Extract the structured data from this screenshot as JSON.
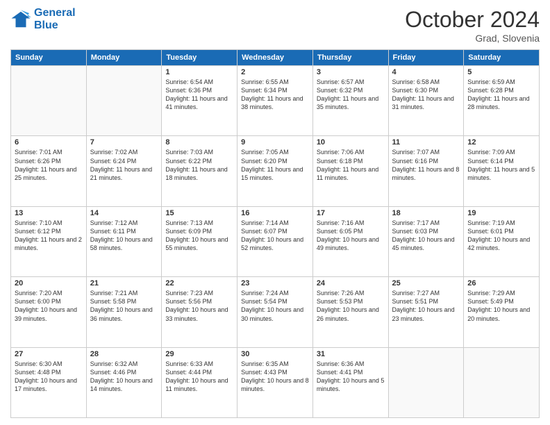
{
  "header": {
    "logo_line1": "General",
    "logo_line2": "Blue",
    "month_title": "October 2024",
    "subtitle": "Grad, Slovenia"
  },
  "weekdays": [
    "Sunday",
    "Monday",
    "Tuesday",
    "Wednesday",
    "Thursday",
    "Friday",
    "Saturday"
  ],
  "weeks": [
    [
      {
        "day": "",
        "info": ""
      },
      {
        "day": "",
        "info": ""
      },
      {
        "day": "1",
        "info": "Sunrise: 6:54 AM\nSunset: 6:36 PM\nDaylight: 11 hours and 41 minutes."
      },
      {
        "day": "2",
        "info": "Sunrise: 6:55 AM\nSunset: 6:34 PM\nDaylight: 11 hours and 38 minutes."
      },
      {
        "day": "3",
        "info": "Sunrise: 6:57 AM\nSunset: 6:32 PM\nDaylight: 11 hours and 35 minutes."
      },
      {
        "day": "4",
        "info": "Sunrise: 6:58 AM\nSunset: 6:30 PM\nDaylight: 11 hours and 31 minutes."
      },
      {
        "day": "5",
        "info": "Sunrise: 6:59 AM\nSunset: 6:28 PM\nDaylight: 11 hours and 28 minutes."
      }
    ],
    [
      {
        "day": "6",
        "info": "Sunrise: 7:01 AM\nSunset: 6:26 PM\nDaylight: 11 hours and 25 minutes."
      },
      {
        "day": "7",
        "info": "Sunrise: 7:02 AM\nSunset: 6:24 PM\nDaylight: 11 hours and 21 minutes."
      },
      {
        "day": "8",
        "info": "Sunrise: 7:03 AM\nSunset: 6:22 PM\nDaylight: 11 hours and 18 minutes."
      },
      {
        "day": "9",
        "info": "Sunrise: 7:05 AM\nSunset: 6:20 PM\nDaylight: 11 hours and 15 minutes."
      },
      {
        "day": "10",
        "info": "Sunrise: 7:06 AM\nSunset: 6:18 PM\nDaylight: 11 hours and 11 minutes."
      },
      {
        "day": "11",
        "info": "Sunrise: 7:07 AM\nSunset: 6:16 PM\nDaylight: 11 hours and 8 minutes."
      },
      {
        "day": "12",
        "info": "Sunrise: 7:09 AM\nSunset: 6:14 PM\nDaylight: 11 hours and 5 minutes."
      }
    ],
    [
      {
        "day": "13",
        "info": "Sunrise: 7:10 AM\nSunset: 6:12 PM\nDaylight: 11 hours and 2 minutes."
      },
      {
        "day": "14",
        "info": "Sunrise: 7:12 AM\nSunset: 6:11 PM\nDaylight: 10 hours and 58 minutes."
      },
      {
        "day": "15",
        "info": "Sunrise: 7:13 AM\nSunset: 6:09 PM\nDaylight: 10 hours and 55 minutes."
      },
      {
        "day": "16",
        "info": "Sunrise: 7:14 AM\nSunset: 6:07 PM\nDaylight: 10 hours and 52 minutes."
      },
      {
        "day": "17",
        "info": "Sunrise: 7:16 AM\nSunset: 6:05 PM\nDaylight: 10 hours and 49 minutes."
      },
      {
        "day": "18",
        "info": "Sunrise: 7:17 AM\nSunset: 6:03 PM\nDaylight: 10 hours and 45 minutes."
      },
      {
        "day": "19",
        "info": "Sunrise: 7:19 AM\nSunset: 6:01 PM\nDaylight: 10 hours and 42 minutes."
      }
    ],
    [
      {
        "day": "20",
        "info": "Sunrise: 7:20 AM\nSunset: 6:00 PM\nDaylight: 10 hours and 39 minutes."
      },
      {
        "day": "21",
        "info": "Sunrise: 7:21 AM\nSunset: 5:58 PM\nDaylight: 10 hours and 36 minutes."
      },
      {
        "day": "22",
        "info": "Sunrise: 7:23 AM\nSunset: 5:56 PM\nDaylight: 10 hours and 33 minutes."
      },
      {
        "day": "23",
        "info": "Sunrise: 7:24 AM\nSunset: 5:54 PM\nDaylight: 10 hours and 30 minutes."
      },
      {
        "day": "24",
        "info": "Sunrise: 7:26 AM\nSunset: 5:53 PM\nDaylight: 10 hours and 26 minutes."
      },
      {
        "day": "25",
        "info": "Sunrise: 7:27 AM\nSunset: 5:51 PM\nDaylight: 10 hours and 23 minutes."
      },
      {
        "day": "26",
        "info": "Sunrise: 7:29 AM\nSunset: 5:49 PM\nDaylight: 10 hours and 20 minutes."
      }
    ],
    [
      {
        "day": "27",
        "info": "Sunrise: 6:30 AM\nSunset: 4:48 PM\nDaylight: 10 hours and 17 minutes."
      },
      {
        "day": "28",
        "info": "Sunrise: 6:32 AM\nSunset: 4:46 PM\nDaylight: 10 hours and 14 minutes."
      },
      {
        "day": "29",
        "info": "Sunrise: 6:33 AM\nSunset: 4:44 PM\nDaylight: 10 hours and 11 minutes."
      },
      {
        "day": "30",
        "info": "Sunrise: 6:35 AM\nSunset: 4:43 PM\nDaylight: 10 hours and 8 minutes."
      },
      {
        "day": "31",
        "info": "Sunrise: 6:36 AM\nSunset: 4:41 PM\nDaylight: 10 hours and 5 minutes."
      },
      {
        "day": "",
        "info": ""
      },
      {
        "day": "",
        "info": ""
      }
    ]
  ]
}
